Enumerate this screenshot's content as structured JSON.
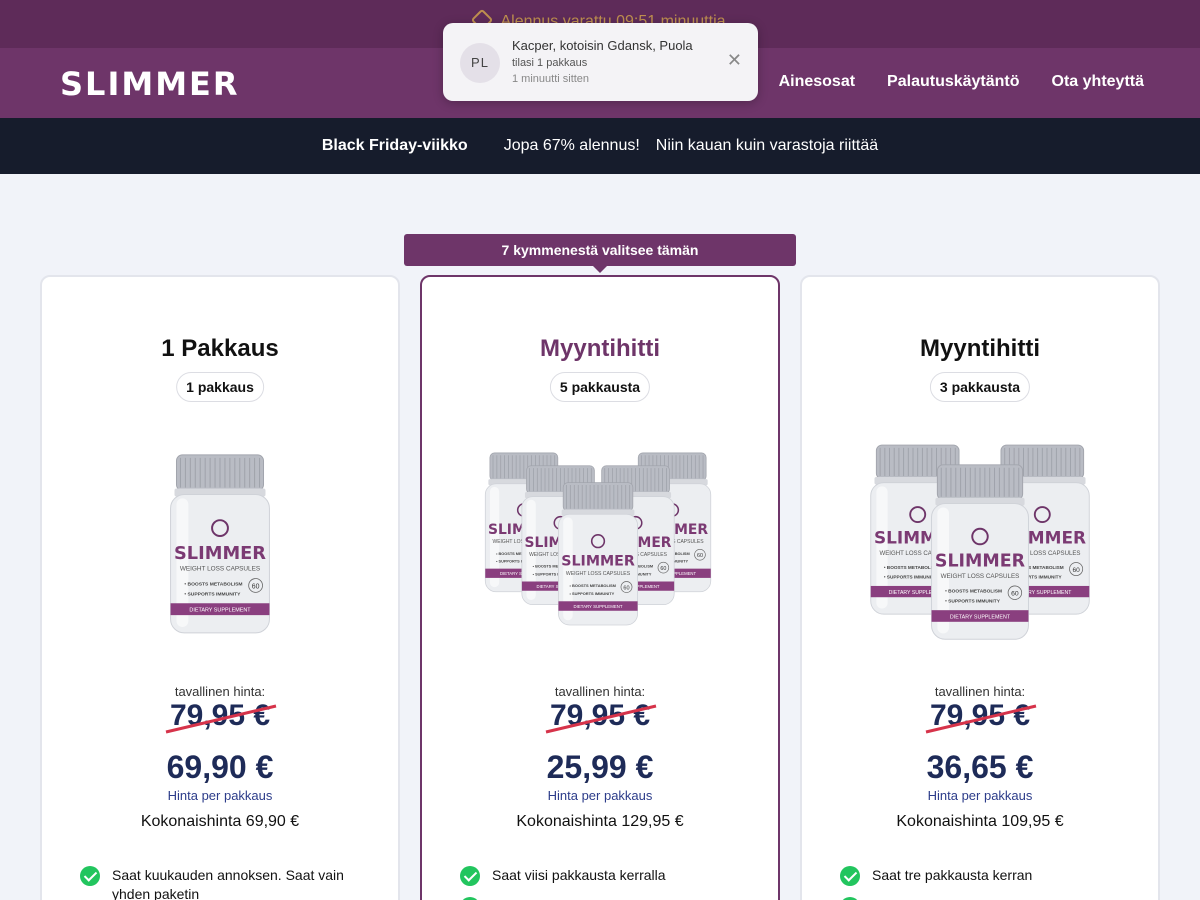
{
  "topbar": {
    "text": "Alennus varattu 09:51 minuuttia"
  },
  "header": {
    "logo": "SLIMMER",
    "nav": [
      "Ainesosat",
      "Palautuskäytäntö",
      "Ota yhteyttä"
    ]
  },
  "toast": {
    "avatar": "PL",
    "name": "Kacper, kotoisin Gdansk, Puola",
    "action": "tilasi 1 pakkaus",
    "time": "1 minuutti sitten"
  },
  "promo": {
    "title": "Black Friday-viikko",
    "discount": "Jopa 67% alennus!",
    "note": "Niin kauan kuin varastoja riittää"
  },
  "ribbon": "7 kymmenestä valitsee tämän",
  "bottle": {
    "brand": "SLIMMER",
    "subtitle": "WEIGHT LOSS CAPSULES",
    "footer": "DIETARY SUPPLEMENT",
    "count": "60",
    "bullets": [
      "BOOSTS METABOLISM",
      "SUPPORTS IMMUNITY"
    ]
  },
  "cards": [
    {
      "title": "1 Pakkaus",
      "pill": "1 pakkaus",
      "bottles": 1,
      "regular_label": "tavallinen hinta:",
      "old_price": "79,95 €",
      "price": "69,90 €",
      "per_label": "Hinta per pakkaus",
      "total": "Kokonaishinta 69,90 €",
      "feature": "Saat kuukauden annoksen. Saat vain yhden paketin"
    },
    {
      "title": "Myyntihitti",
      "pill": "5 pakkausta",
      "bottles": 5,
      "regular_label": "tavallinen hinta:",
      "old_price": "79,95 €",
      "price": "25,99 €",
      "per_label": "Hinta per pakkaus",
      "total": "Kokonaishinta 129,95 €",
      "feature": "Saat viisi pakkausta kerralla"
    },
    {
      "title": "Myyntihitti",
      "pill": "3 pakkausta",
      "bottles": 3,
      "regular_label": "tavallinen hinta:",
      "old_price": "79,95 €",
      "price": "36,65 €",
      "per_label": "Hinta per pakkaus",
      "total": "Kokonaishinta 109,95 €",
      "feature": "Saat tre pakkausta kerran"
    }
  ],
  "colors": {
    "brand": "#6e3569",
    "topbar": "#5e2b59",
    "promo": "#161c2c",
    "price": "#1e2b58",
    "check": "#22c55e",
    "strike": "#d6334a"
  }
}
